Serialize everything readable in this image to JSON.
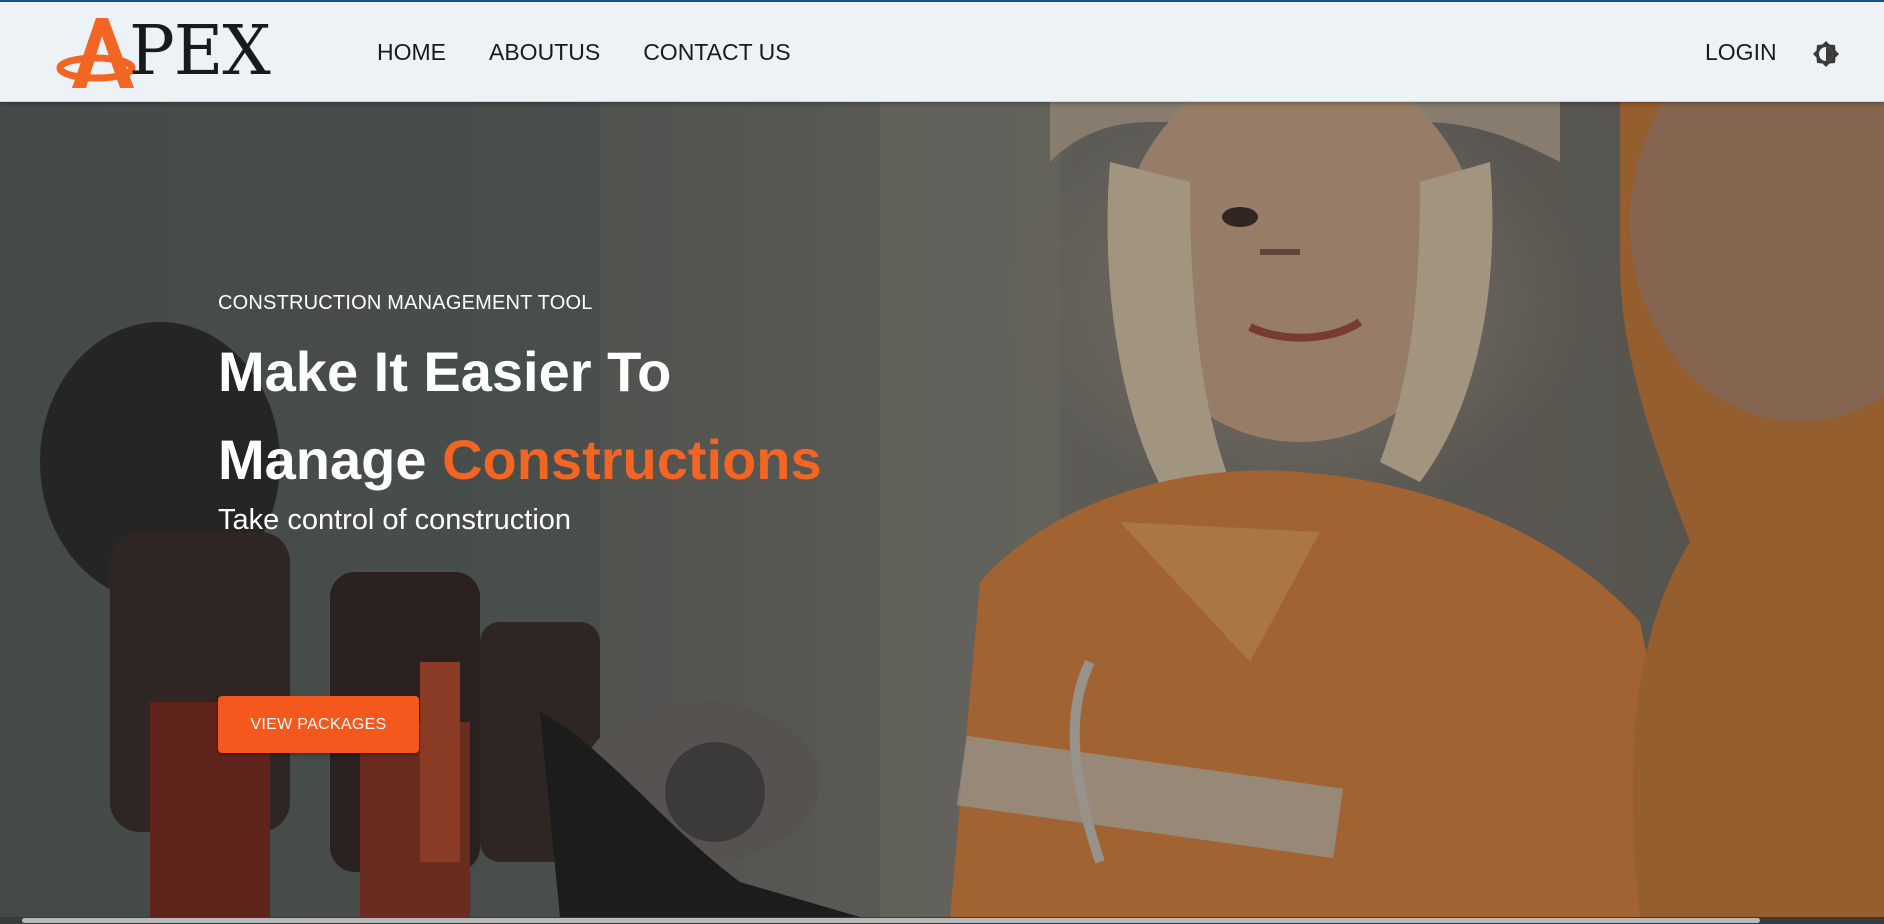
{
  "brand": {
    "logo_text": "PEX",
    "logo_initial": "A",
    "accent_color": "#f26522",
    "button_color": "#f5581c"
  },
  "nav": {
    "items": [
      {
        "label": "HOME"
      },
      {
        "label": "ABOUTUS"
      },
      {
        "label": "CONTACT US"
      }
    ],
    "login_label": "LOGIN",
    "theme_icon": "theme-toggle-icon"
  },
  "hero": {
    "eyebrow": "CONSTRUCTION MANAGEMENT TOOL",
    "headline_line1": "Make It Easier To",
    "headline_line2_prefix": "Manage ",
    "headline_line2_accent": "Constructions",
    "subhead": "Take control of construction",
    "cta_label": "VIEW PACKAGES"
  }
}
